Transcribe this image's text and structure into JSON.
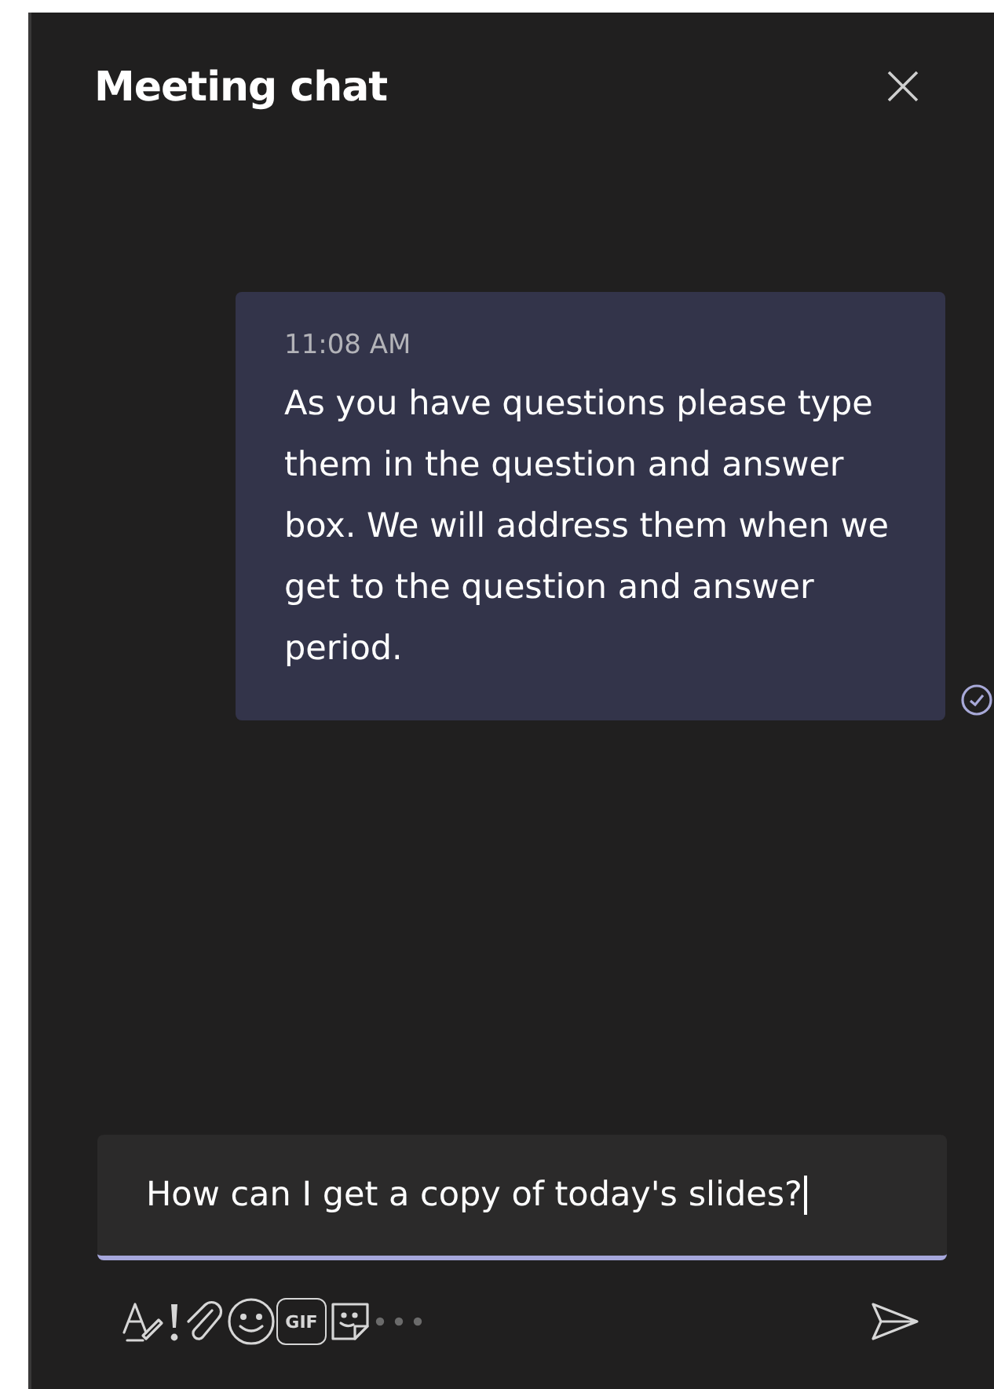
{
  "header": {
    "title": "Meeting chat"
  },
  "messages": [
    {
      "time": "11:08 AM",
      "text": "As you have questions please type them in the question and answer box. We will address them when we get to the question and answer period.",
      "seen": true
    }
  ],
  "compose": {
    "value": "How can I get a copy of today's slides?",
    "focused": true
  },
  "toolbar": [
    {
      "kind": "format"
    },
    {
      "kind": "important"
    },
    {
      "kind": "attach"
    },
    {
      "kind": "emoji"
    },
    {
      "kind": "gif",
      "label": "GIF"
    },
    {
      "kind": "sticker"
    },
    {
      "kind": "more"
    },
    {
      "kind": "send"
    }
  ]
}
